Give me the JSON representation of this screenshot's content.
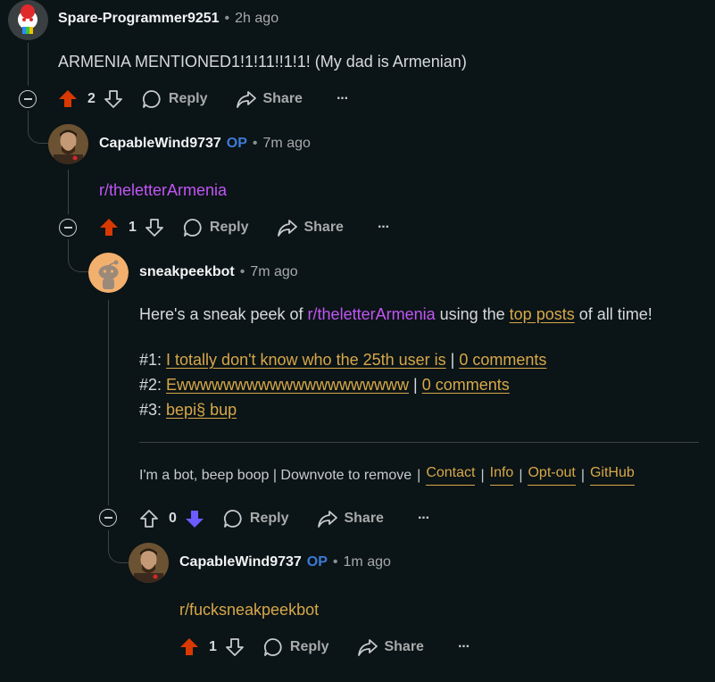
{
  "comments": [
    {
      "author": "Spare-Programmer9251",
      "time": "2h ago",
      "body": "ARMENIA MENTIONED1!1!11!!1!1! (My dad is Armenian)",
      "votes": "2",
      "reply_label": "Reply",
      "share_label": "Share",
      "more_label": "···"
    },
    {
      "author": "CapableWind9737",
      "op_badge": "OP",
      "time": "7m ago",
      "body": "r/theletterArmenia",
      "votes": "1",
      "reply_label": "Reply",
      "share_label": "Share",
      "more_label": "···"
    },
    {
      "author": "sneakpeekbot",
      "time": "7m ago",
      "body_prefix": "Here's a sneak peek of ",
      "body_sub": "r/theletterArmenia",
      "body_mid": " using the ",
      "body_link": "top posts",
      "body_suffix": " of all time!",
      "posts": [
        {
          "num": "#1: ",
          "title": "I totally don't know who the 25th user is",
          "sep": " | ",
          "comments": "0 comments"
        },
        {
          "num": "#2: ",
          "title": "Ewwwwwwwwwwwwwwwwwwww",
          "sep": " | ",
          "comments": "0 comments"
        },
        {
          "num": "#3: ",
          "title": "bepi§ bup"
        }
      ],
      "footer_text": "I'm a bot, beep boop | Downvote to remove",
      "footer_links": [
        "Contact",
        "Info",
        "Opt-out",
        "GitHub"
      ],
      "votes": "0",
      "reply_label": "Reply",
      "share_label": "Share",
      "more_label": "···"
    },
    {
      "author": "CapableWind9737",
      "op_badge": "OP",
      "time": "1m ago",
      "body": "r/fucksneakpeekbot",
      "votes": "1",
      "reply_label": "Reply",
      "share_label": "Share",
      "more_label": "···"
    }
  ],
  "colors": {
    "background": "#0b1416",
    "upvote_active": "#d93900",
    "downvote_active": "#6a5cff",
    "op_badge": "#3d7bd6",
    "subreddit_link": "#c255f5",
    "link": "#d7a84a"
  },
  "icons": [
    "upvote-icon",
    "downvote-icon",
    "reply-bubble-icon",
    "share-icon",
    "collapse-icon",
    "more-icon"
  ]
}
